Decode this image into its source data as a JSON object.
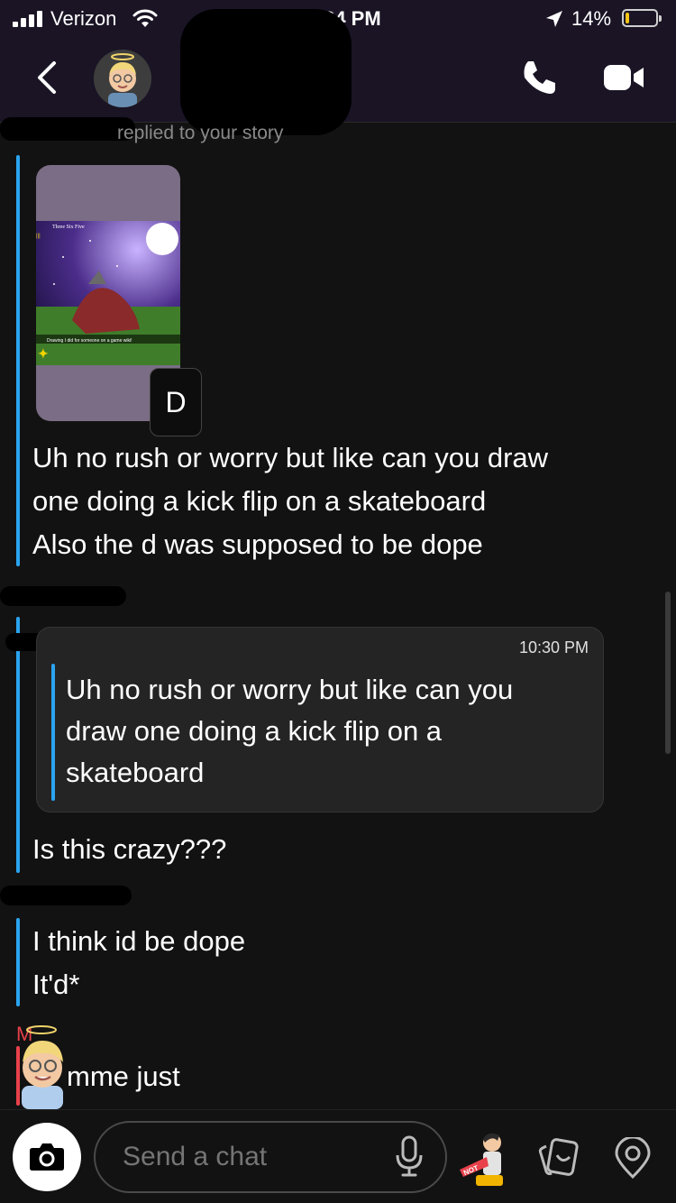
{
  "status_bar": {
    "carrier": "Verizon",
    "time": "10:34 PM",
    "battery": "14%",
    "battery_level": 0.14
  },
  "header": {
    "back": "back",
    "avatar": "bitmoji-avatar"
  },
  "chat": {
    "replied_label": "replied to your story",
    "story_thumb": {
      "song": "Three Six Five",
      "caption": "Drawing I did for someone on a game wiki!"
    },
    "reply_letter": "D",
    "message_1": "Uh no rush or worry but like can you draw\none doing a kick flip on a skateboard\nAlso the d was supposed to be dope",
    "quote": {
      "time": "10:30 PM",
      "text": "Uh no rush or worry but like can you\ndraw one doing a kick flip on a\nskateboard"
    },
    "message_2": "Is this crazy???",
    "message_3": "I think id be dope\nIt'd*",
    "typing_label": "M",
    "message_4": "mme just"
  },
  "composer": {
    "placeholder": "Send a chat"
  },
  "icons": {
    "camera": "camera-icon",
    "mic": "microphone-icon",
    "sticker": "sticker-icon",
    "cards": "cards-icon",
    "location": "location-icon",
    "call": "phone-icon",
    "video": "video-icon"
  },
  "colors": {
    "me": "#2aa4ef",
    "friend": "#e8414b",
    "header": "#1a1425"
  }
}
